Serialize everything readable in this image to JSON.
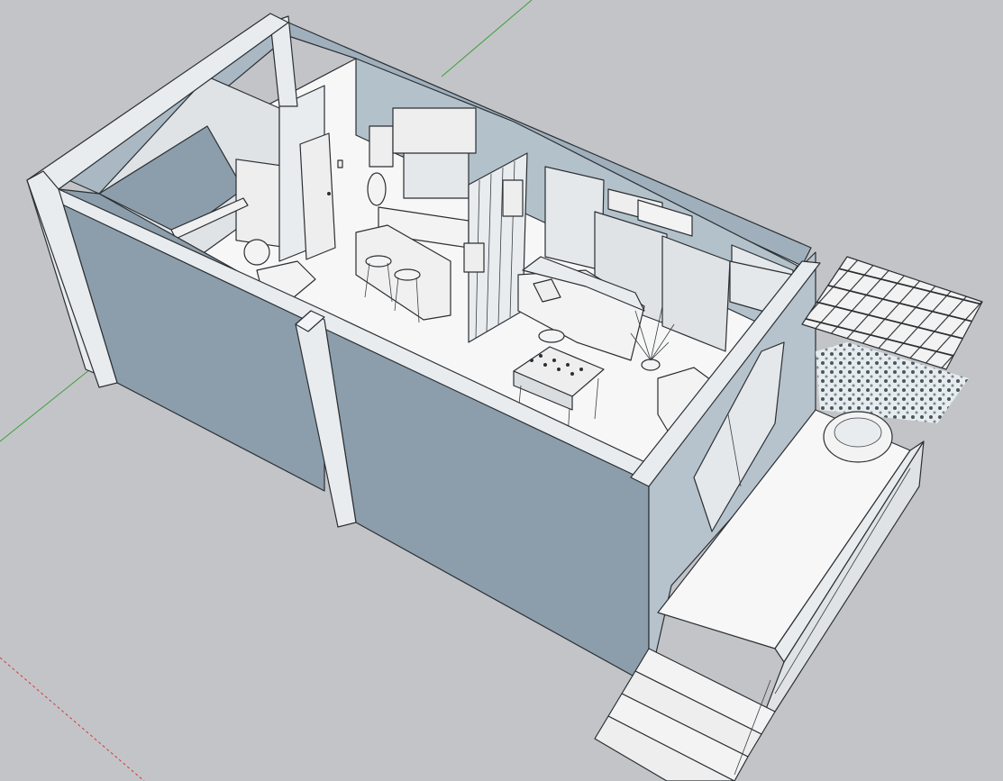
{
  "app": {
    "view": "3d-model-viewport"
  },
  "colors": {
    "background": "#c3c4c8",
    "wall_dark": "#8c9eab",
    "wall_mid": "#9fb0bc",
    "wall_light": "#b6c3cc",
    "wall_top": "#e9ecee",
    "floor": "#f7f7f7",
    "furniture": "#f3f3f3",
    "edge": "#2b2f33",
    "axis_red": "#d23a3a",
    "axis_green": "#3aa03a"
  },
  "scene": {
    "objects": [
      "exterior-wall-front",
      "exterior-wall-left",
      "exterior-wall-back",
      "interior-partition",
      "bathroom-door",
      "kitchen-counter",
      "bar-stools",
      "slatted-divider",
      "sofa",
      "foosball-table",
      "wall-air-conditioner",
      "window-panels",
      "potted-plant",
      "armchair",
      "pergola",
      "patio-chair",
      "entry-stairs",
      "balcony-railing"
    ]
  }
}
